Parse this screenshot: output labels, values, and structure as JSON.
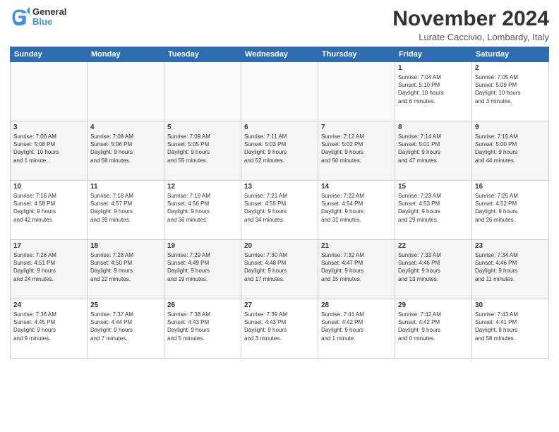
{
  "logo": {
    "general": "General",
    "blue": "Blue"
  },
  "header": {
    "title": "November 2024",
    "location": "Lurate Caccivio, Lombardy, Italy"
  },
  "days_of_week": [
    "Sunday",
    "Monday",
    "Tuesday",
    "Wednesday",
    "Thursday",
    "Friday",
    "Saturday"
  ],
  "weeks": [
    [
      {
        "day": "",
        "info": "",
        "empty": true
      },
      {
        "day": "",
        "info": "",
        "empty": true
      },
      {
        "day": "",
        "info": "",
        "empty": true
      },
      {
        "day": "",
        "info": "",
        "empty": true
      },
      {
        "day": "",
        "info": "",
        "empty": true
      },
      {
        "day": "1",
        "info": "Sunrise: 7:04 AM\nSunset: 5:10 PM\nDaylight: 10 hours\nand 6 minutes."
      },
      {
        "day": "2",
        "info": "Sunrise: 7:05 AM\nSunset: 5:09 PM\nDaylight: 10 hours\nand 3 minutes."
      }
    ],
    [
      {
        "day": "3",
        "info": "Sunrise: 7:06 AM\nSunset: 5:08 PM\nDaylight: 10 hours\nand 1 minute."
      },
      {
        "day": "4",
        "info": "Sunrise: 7:08 AM\nSunset: 5:06 PM\nDaylight: 9 hours\nand 58 minutes."
      },
      {
        "day": "5",
        "info": "Sunrise: 7:09 AM\nSunset: 5:05 PM\nDaylight: 9 hours\nand 55 minutes."
      },
      {
        "day": "6",
        "info": "Sunrise: 7:11 AM\nSunset: 5:03 PM\nDaylight: 9 hours\nand 52 minutes."
      },
      {
        "day": "7",
        "info": "Sunrise: 7:12 AM\nSunset: 5:02 PM\nDaylight: 9 hours\nand 50 minutes."
      },
      {
        "day": "8",
        "info": "Sunrise: 7:14 AM\nSunset: 5:01 PM\nDaylight: 9 hours\nand 47 minutes."
      },
      {
        "day": "9",
        "info": "Sunrise: 7:15 AM\nSunset: 5:00 PM\nDaylight: 9 hours\nand 44 minutes."
      }
    ],
    [
      {
        "day": "10",
        "info": "Sunrise: 7:16 AM\nSunset: 4:58 PM\nDaylight: 9 hours\nand 42 minutes."
      },
      {
        "day": "11",
        "info": "Sunrise: 7:18 AM\nSunset: 4:57 PM\nDaylight: 9 hours\nand 39 minutes."
      },
      {
        "day": "12",
        "info": "Sunrise: 7:19 AM\nSunset: 4:56 PM\nDaylight: 9 hours\nand 36 minutes."
      },
      {
        "day": "13",
        "info": "Sunrise: 7:21 AM\nSunset: 4:55 PM\nDaylight: 9 hours\nand 34 minutes."
      },
      {
        "day": "14",
        "info": "Sunrise: 7:22 AM\nSunset: 4:54 PM\nDaylight: 9 hours\nand 31 minutes."
      },
      {
        "day": "15",
        "info": "Sunrise: 7:23 AM\nSunset: 4:53 PM\nDaylight: 9 hours\nand 29 minutes."
      },
      {
        "day": "16",
        "info": "Sunrise: 7:25 AM\nSunset: 4:52 PM\nDaylight: 9 hours\nand 26 minutes."
      }
    ],
    [
      {
        "day": "17",
        "info": "Sunrise: 7:26 AM\nSunset: 4:51 PM\nDaylight: 9 hours\nand 24 minutes."
      },
      {
        "day": "18",
        "info": "Sunrise: 7:28 AM\nSunset: 4:50 PM\nDaylight: 9 hours\nand 22 minutes."
      },
      {
        "day": "19",
        "info": "Sunrise: 7:29 AM\nSunset: 4:49 PM\nDaylight: 9 hours\nand 19 minutes."
      },
      {
        "day": "20",
        "info": "Sunrise: 7:30 AM\nSunset: 4:48 PM\nDaylight: 9 hours\nand 17 minutes."
      },
      {
        "day": "21",
        "info": "Sunrise: 7:32 AM\nSunset: 4:47 PM\nDaylight: 9 hours\nand 15 minutes."
      },
      {
        "day": "22",
        "info": "Sunrise: 7:33 AM\nSunset: 4:46 PM\nDaylight: 9 hours\nand 13 minutes."
      },
      {
        "day": "23",
        "info": "Sunrise: 7:34 AM\nSunset: 4:46 PM\nDaylight: 9 hours\nand 11 minutes."
      }
    ],
    [
      {
        "day": "24",
        "info": "Sunrise: 7:36 AM\nSunset: 4:45 PM\nDaylight: 9 hours\nand 9 minutes."
      },
      {
        "day": "25",
        "info": "Sunrise: 7:37 AM\nSunset: 4:44 PM\nDaylight: 9 hours\nand 7 minutes."
      },
      {
        "day": "26",
        "info": "Sunrise: 7:38 AM\nSunset: 4:43 PM\nDaylight: 9 hours\nand 5 minutes."
      },
      {
        "day": "27",
        "info": "Sunrise: 7:39 AM\nSunset: 4:43 PM\nDaylight: 9 hours\nand 3 minutes."
      },
      {
        "day": "28",
        "info": "Sunrise: 7:41 AM\nSunset: 4:42 PM\nDaylight: 9 hours\nand 1 minute."
      },
      {
        "day": "29",
        "info": "Sunrise: 7:42 AM\nSunset: 4:42 PM\nDaylight: 9 hours\nand 0 minutes."
      },
      {
        "day": "30",
        "info": "Sunrise: 7:43 AM\nSunset: 4:41 PM\nDaylight: 8 hours\nand 58 minutes."
      }
    ]
  ]
}
